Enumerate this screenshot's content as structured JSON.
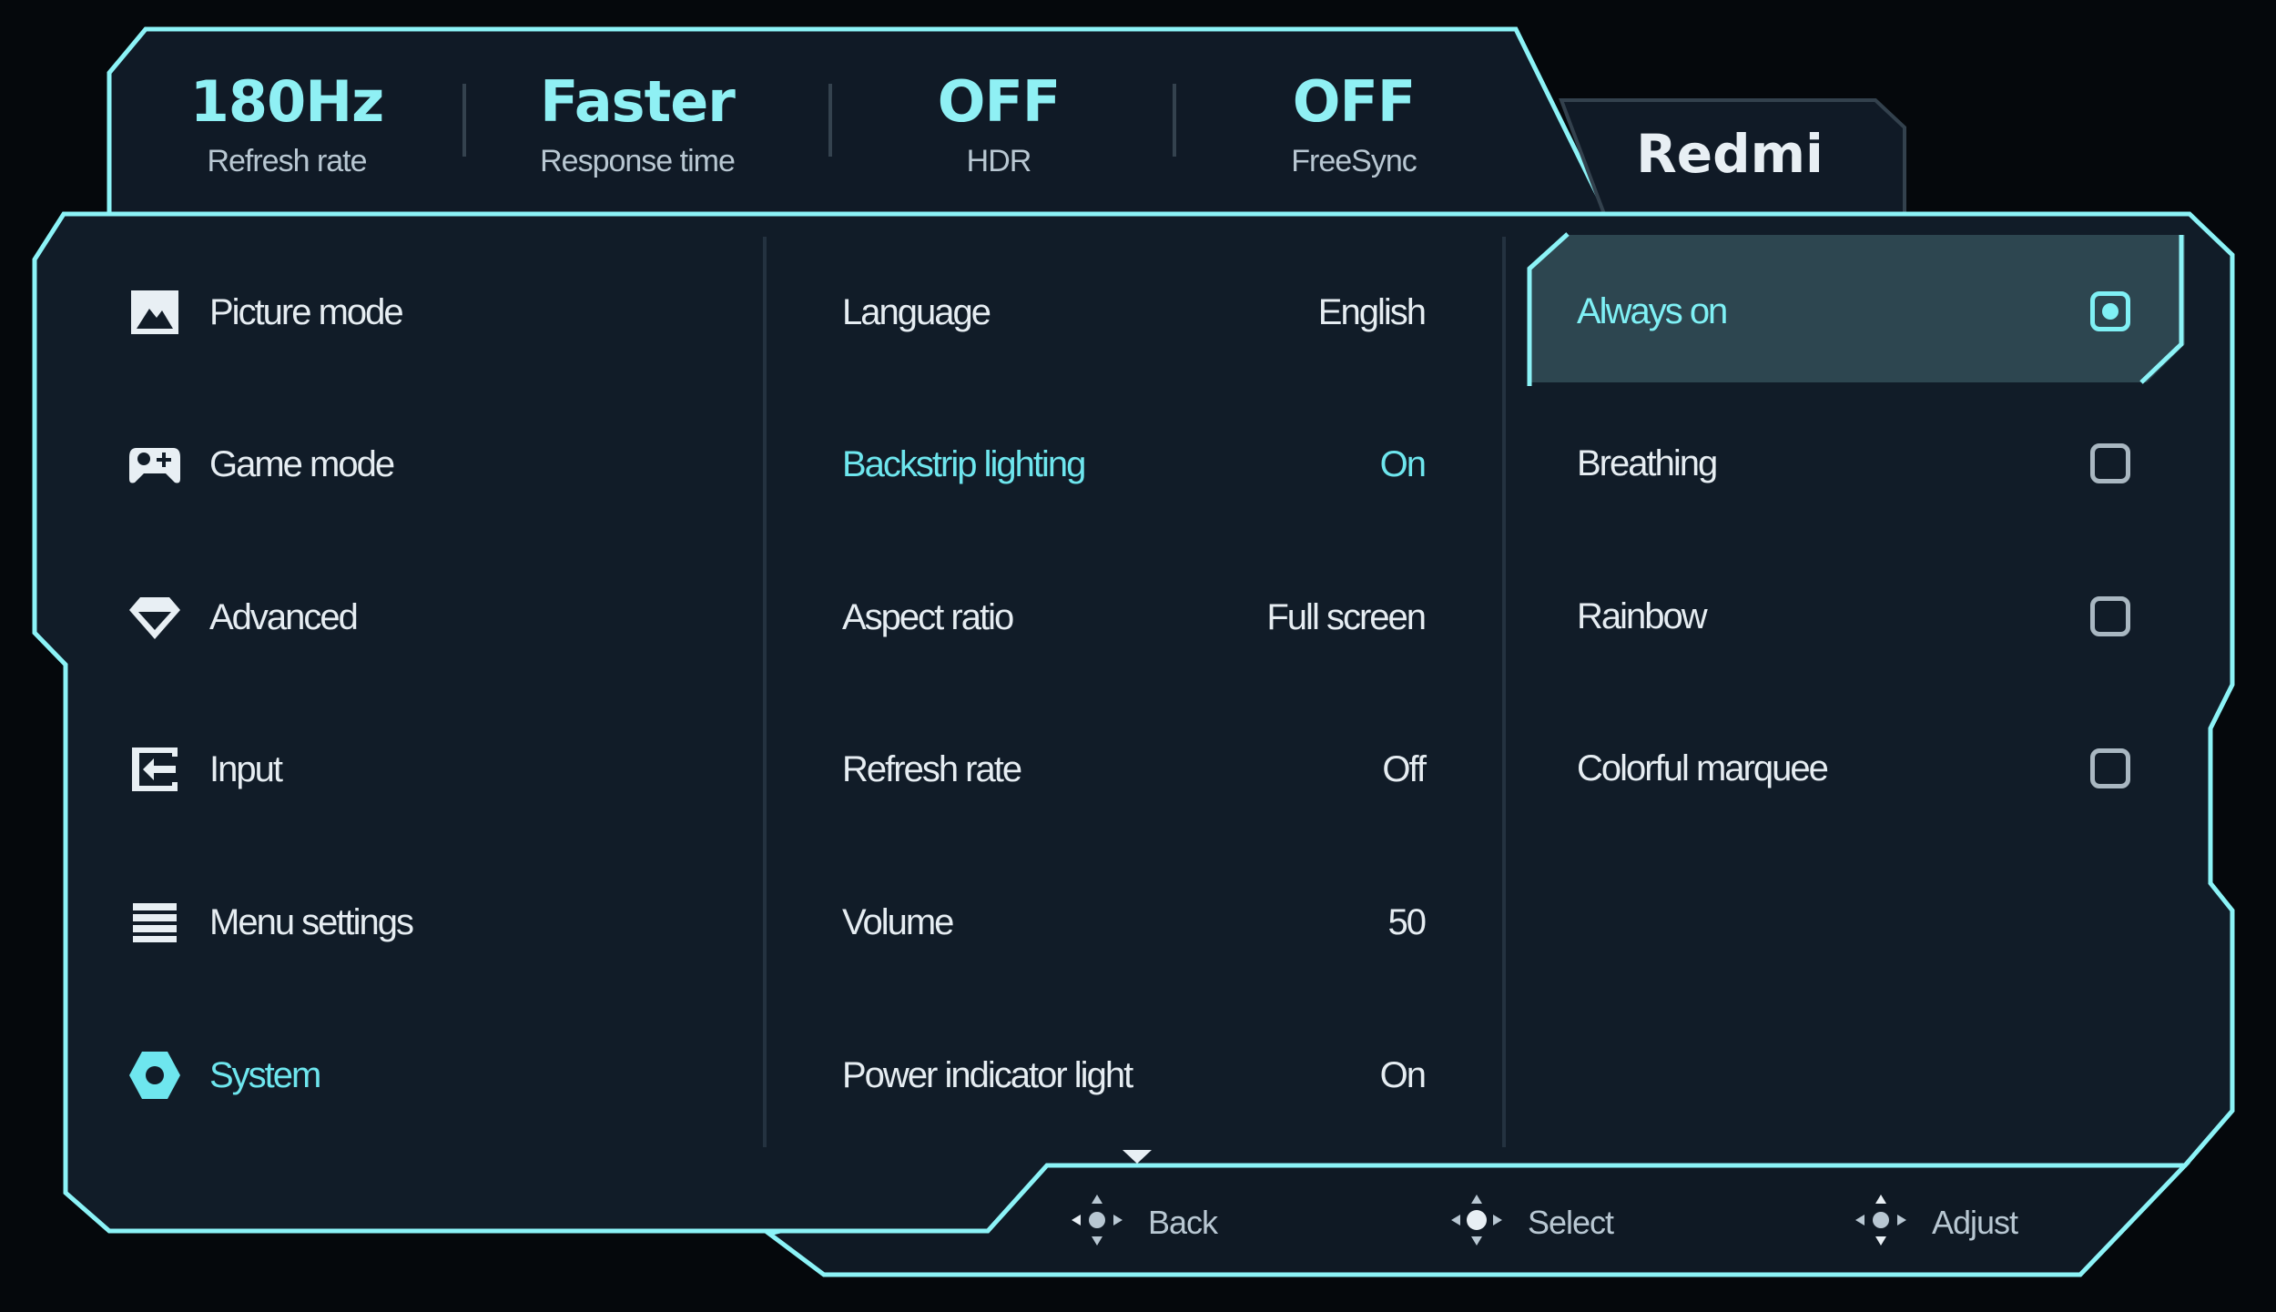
{
  "top_bar": {
    "stats": [
      {
        "value": "180Hz",
        "label": "Refresh rate"
      },
      {
        "value": "Faster",
        "label": "Response time"
      },
      {
        "value": "OFF",
        "label": "HDR"
      },
      {
        "value": "OFF",
        "label": "FreeSync"
      }
    ],
    "brand": "Redmi"
  },
  "sidebar": {
    "items": [
      {
        "label": "Picture mode",
        "icon": "picture-icon"
      },
      {
        "label": "Game mode",
        "icon": "gamepad-icon"
      },
      {
        "label": "Advanced",
        "icon": "diamond-icon"
      },
      {
        "label": "Input",
        "icon": "input-icon"
      },
      {
        "label": "Menu settings",
        "icon": "menu-icon"
      },
      {
        "label": "System",
        "icon": "settings-hexagon-icon",
        "active": true
      }
    ]
  },
  "settings": {
    "rows": [
      {
        "label": "Language",
        "value": "English"
      },
      {
        "label": "Backstrip lighting",
        "value": "On",
        "active": true
      },
      {
        "label": "Aspect ratio",
        "value": "Full screen"
      },
      {
        "label": "Refresh rate",
        "value": "Off"
      },
      {
        "label": "Volume",
        "value": "50"
      },
      {
        "label": "Power indicator light",
        "value": "On"
      }
    ],
    "more_indicator": "down-arrow-icon"
  },
  "options": {
    "items": [
      {
        "label": "Always on",
        "selected": true
      },
      {
        "label": "Breathing",
        "selected": false
      },
      {
        "label": "Rainbow",
        "selected": false
      },
      {
        "label": "Colorful marquee",
        "selected": false
      }
    ]
  },
  "footer": {
    "hints": [
      {
        "label": "Back",
        "icon": "joystick-left-icon"
      },
      {
        "label": "Select",
        "icon": "joystick-press-icon"
      },
      {
        "label": "Adjust",
        "icon": "joystick-updown-icon"
      }
    ]
  },
  "colors": {
    "accent": "#6ee6ee",
    "background": "#05080c",
    "panel": "#111c28",
    "border": "#7feef4"
  }
}
